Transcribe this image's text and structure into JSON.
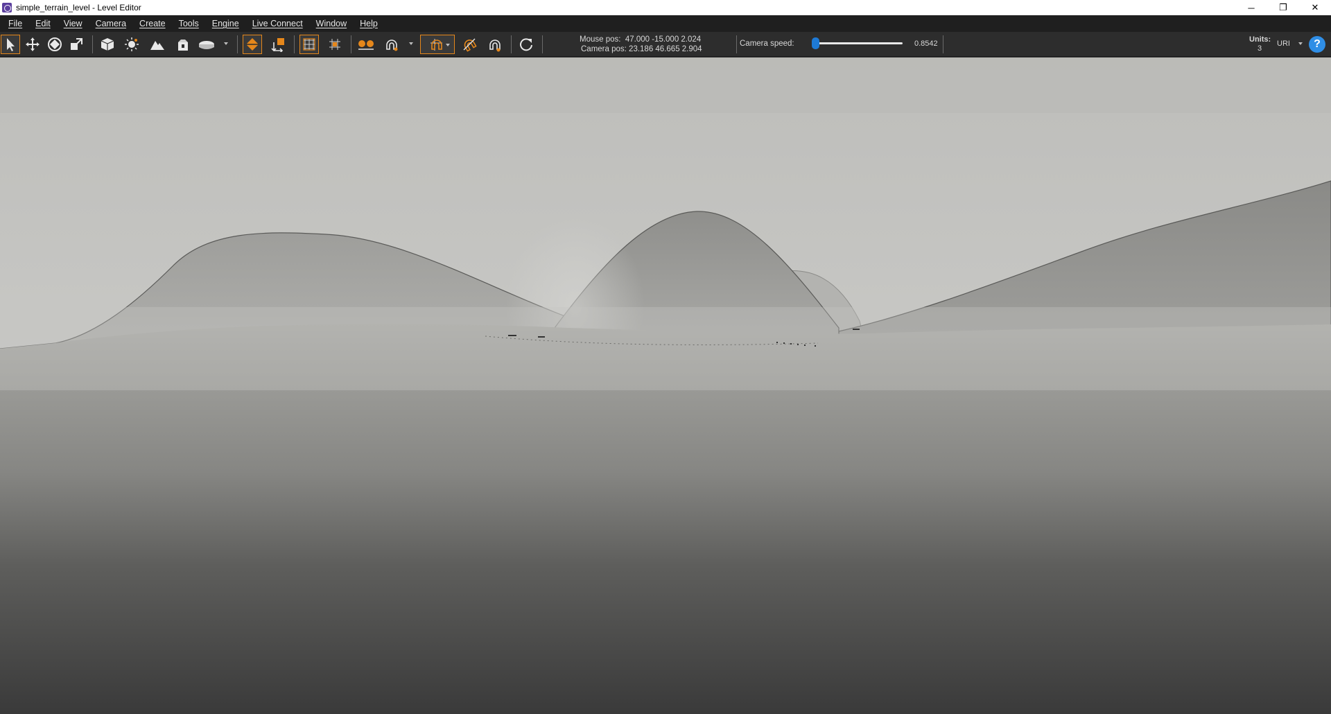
{
  "window": {
    "title": "simple_terrain_level - Level Editor",
    "controls": {
      "minimize": "─",
      "restore": "❐",
      "close": "✕"
    }
  },
  "menu": [
    "File",
    "Edit",
    "View",
    "Camera",
    "Create",
    "Tools",
    "Engine",
    "Live Connect",
    "Window",
    "Help"
  ],
  "toolbar": {
    "mouse_pos_label": "Mouse pos:",
    "mouse_pos_value": "47.000 -15.000 2.024",
    "camera_pos_label": "Camera pos:",
    "camera_pos_value": "23.186 46.665 2.904",
    "camera_speed_label": "Camera speed:",
    "camera_speed_value": "0.8542",
    "camera_speed_fraction": 0.03,
    "units_label": "Units:",
    "units_value": "3",
    "units_select": "URI",
    "help_icon": "?"
  },
  "colors": {
    "accent": "#e5871b",
    "slider": "#1e7ad6",
    "help": "#2f8ee6"
  },
  "icons": [
    "select-icon",
    "move-icon",
    "rotate-icon",
    "scale-icon",
    "cube-icon",
    "light-icon",
    "terrain-icon",
    "prefab-icon",
    "plane-icon",
    "snap-surface-icon",
    "snap-axis-icon",
    "grid-icon",
    "grid-alt-icon",
    "group-icon",
    "magnet-icon",
    "snap-grid-icon",
    "pivot-magnet-icon",
    "snap-magnet-icon",
    "refresh-icon",
    "help-icon"
  ]
}
